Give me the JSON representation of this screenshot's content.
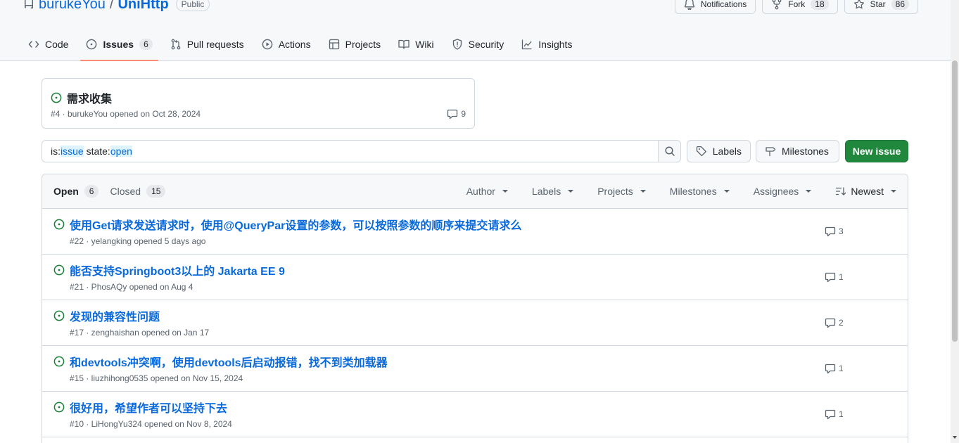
{
  "repo": {
    "owner": "burukeYou",
    "separator": "/",
    "name": "UniHttp",
    "visibility": "Public",
    "notifications_label": "Notifications",
    "fork_label": "Fork",
    "fork_count": "18",
    "star_label": "Star",
    "star_count": "86"
  },
  "tabs": [
    {
      "label": "Code",
      "icon": "code-icon"
    },
    {
      "label": "Issues",
      "icon": "issue-opened-icon",
      "count": "6",
      "active": true
    },
    {
      "label": "Pull requests",
      "icon": "git-pull-request-icon"
    },
    {
      "label": "Actions",
      "icon": "play-icon"
    },
    {
      "label": "Projects",
      "icon": "table-icon"
    },
    {
      "label": "Wiki",
      "icon": "book-icon"
    },
    {
      "label": "Security",
      "icon": "shield-icon"
    },
    {
      "label": "Insights",
      "icon": "graph-icon"
    }
  ],
  "pinned": {
    "title": "需求收集",
    "meta": "#4 · burukeYou opened on Oct 28, 2024",
    "comments": "9"
  },
  "search": {
    "prefix1": "is:",
    "value1": "issue",
    "prefix2": " state:",
    "value2": "open"
  },
  "buttons": {
    "labels": "Labels",
    "milestones": "Milestones",
    "new_issue": "New issue"
  },
  "list_header": {
    "open_label": "Open",
    "open_count": "6",
    "closed_label": "Closed",
    "closed_count": "15",
    "filters": [
      "Author",
      "Labels",
      "Projects",
      "Milestones",
      "Assignees"
    ],
    "sort_label": "Newest"
  },
  "issues": [
    {
      "title": "使用Get请求发送请求时，使用@QueryPar设置的参数，可以按照参数的顺序来提交请求么",
      "meta": "#22 · yelangking opened 5 days ago",
      "comments": "3"
    },
    {
      "title": "能否支持Springboot3以上的 Jakarta EE 9",
      "meta": "#21 · PhosAQy opened on Aug 4",
      "comments": "1"
    },
    {
      "title": "发现的兼容性问题",
      "meta": "#17 · zenghaishan opened on Jan 17",
      "comments": "2"
    },
    {
      "title": "和devtools冲突啊，使用devtools后启动报错，找不到类加载器",
      "meta": "#15 · liuzhihong0535 opened on Nov 15, 2024",
      "comments": "1"
    },
    {
      "title": "很好用，希望作者可以坚持下去",
      "meta": "#10 · LiHongYu324 opened on Nov 8, 2024",
      "comments": "1"
    }
  ],
  "colors": {
    "accent": "#0969da",
    "open_green": "#1a7f37",
    "new_issue_green": "#1f883d",
    "tab_underline": "#fd8c73"
  }
}
